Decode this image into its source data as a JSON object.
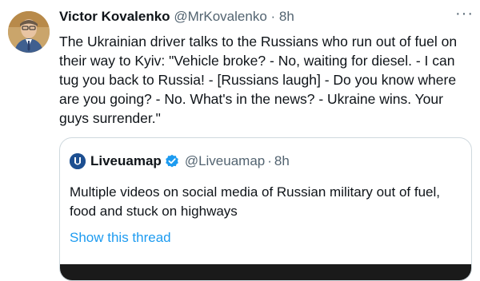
{
  "tweet": {
    "author_name": "Victor Kovalenko",
    "handle": "@MrKovalenko",
    "separator": "·",
    "time": "8h",
    "more_icon": "more-horizontal-icon",
    "more_glyph": "···",
    "text": "The Ukrainian driver talks to the Russians who run out of fuel on their way to Kyiv: \"Vehicle broke? - No, waiting for diesel. - I can tug you back to Russia! - [Russians laugh] - Do you know where are you going? - No. What's in the news? - Ukraine wins. Your guys surrender.\""
  },
  "quoted_tweet": {
    "author_name": "Liveuamap",
    "handle": "@Liveuamap",
    "separator": "·",
    "time": "8h",
    "verified_icon": "verified-badge-icon",
    "text": "Multiple videos on social media of Russian military out of fuel, food and stuck on highways",
    "show_thread_label": "Show this thread"
  },
  "colors": {
    "text": "#0f1419",
    "muted": "#536471",
    "link": "#1d9bf0",
    "border": "#cfd9de",
    "verified": "#1d9bf0"
  }
}
